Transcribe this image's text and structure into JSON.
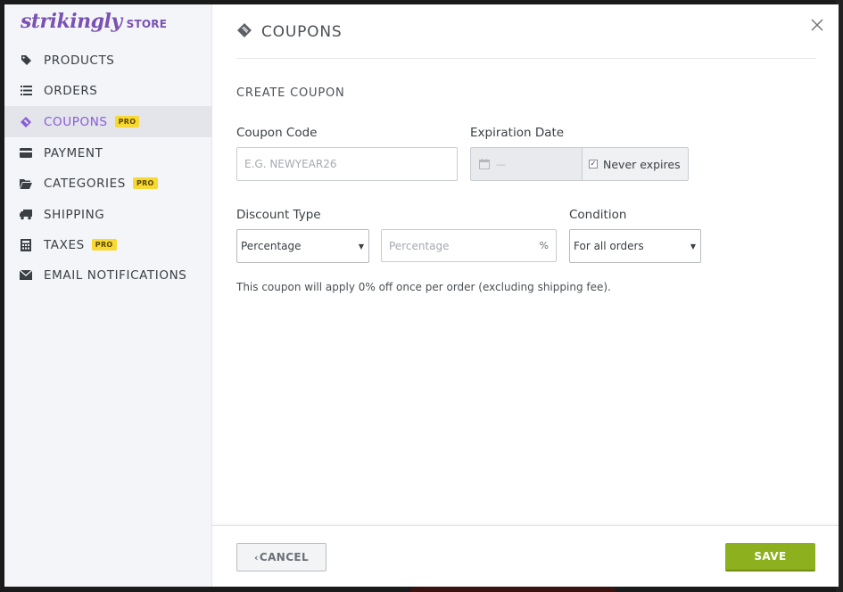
{
  "brand": {
    "logo": "strikingly",
    "store_label": "STORE"
  },
  "sidebar": {
    "items": [
      {
        "label": "PRODUCTS",
        "icon": "tag-icon",
        "pro": false,
        "active": false
      },
      {
        "label": "ORDERS",
        "icon": "list-icon",
        "pro": false,
        "active": false
      },
      {
        "label": "COUPONS",
        "icon": "ticket-icon",
        "pro": true,
        "active": true
      },
      {
        "label": "PAYMENT",
        "icon": "credit-card-icon",
        "pro": false,
        "active": false
      },
      {
        "label": "CATEGORIES",
        "icon": "folder-icon",
        "pro": true,
        "active": false
      },
      {
        "label": "SHIPPING",
        "icon": "truck-icon",
        "pro": false,
        "active": false
      },
      {
        "label": "TAXES",
        "icon": "calculator-icon",
        "pro": true,
        "active": false
      },
      {
        "label": "EMAIL NOTIFICATIONS",
        "icon": "envelope-icon",
        "pro": false,
        "active": false
      }
    ],
    "pro_badge": "PRO"
  },
  "header": {
    "title": "COUPONS",
    "icon": "ticket-icon"
  },
  "form": {
    "section_title": "CREATE COUPON",
    "coupon_code": {
      "label": "Coupon Code",
      "placeholder": "E.G. NEWYEAR26"
    },
    "expiration": {
      "label": "Expiration Date",
      "date_value": "—",
      "never_expires_label": "Never expires",
      "never_expires_checked": true
    },
    "discount_type": {
      "label": "Discount Type",
      "selected": "Percentage"
    },
    "discount_value": {
      "placeholder": "Percentage",
      "unit": "%"
    },
    "condition": {
      "label": "Condition",
      "selected": "For all orders"
    },
    "info": "This coupon will apply 0% off once per order (excluding shipping fee)."
  },
  "footer": {
    "cancel_label": "CANCEL",
    "save_label": "SAVE"
  },
  "colors": {
    "brand": "#7a52b3",
    "active": "#8a5bd6",
    "pro": "#f8d832",
    "save": "#8db11e"
  }
}
